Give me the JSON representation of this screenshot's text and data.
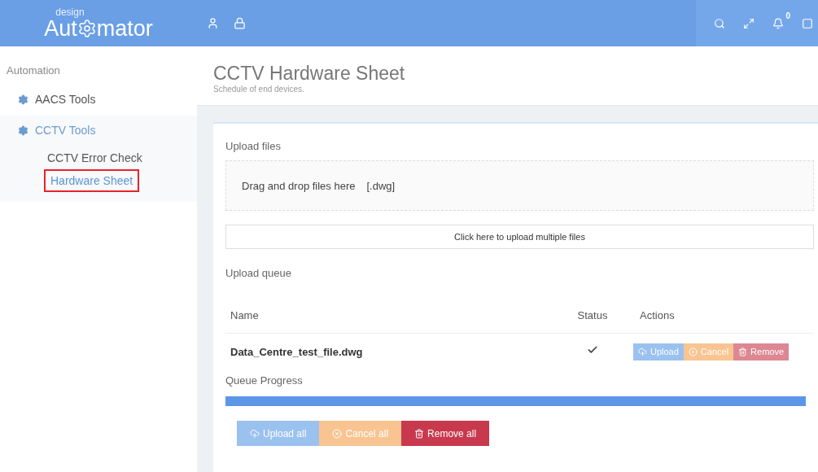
{
  "logo": {
    "small": "design",
    "left": "Aut",
    "right": "mator"
  },
  "header": {
    "notification_count": "0"
  },
  "sidebar": {
    "heading": "Automation",
    "items": [
      {
        "label": "AACS Tools",
        "expanded": false
      },
      {
        "label": "CCTV Tools",
        "expanded": true,
        "children": [
          {
            "label": "CCTV Error Check",
            "selected": false
          },
          {
            "label": "Hardware Sheet",
            "selected": true
          }
        ]
      }
    ]
  },
  "page": {
    "title": "CCTV Hardware Sheet",
    "subtitle": "Schedule of end devices."
  },
  "upload": {
    "heading": "Upload files",
    "drop_text": "Drag and drop files here",
    "drop_ext": "[.dwg]",
    "click_text": "Click here to upload multiple files"
  },
  "queue": {
    "heading": "Upload queue",
    "columns": [
      "Name",
      "Status",
      "Actions"
    ],
    "rows": [
      {
        "name": "Data_Centre_test_file.dwg",
        "done": true,
        "actions": [
          {
            "kind": "upload",
            "label": "Upload",
            "disabled": true
          },
          {
            "kind": "cancel",
            "label": "Cancel",
            "disabled": true
          },
          {
            "kind": "remove",
            "label": "Remove",
            "disabled": true
          }
        ]
      }
    ],
    "progress_label": "Queue Progress",
    "progress": {
      "level": 1
    },
    "buttons": [
      {
        "kind": "upload",
        "label": "Upload all",
        "disabled": true
      },
      {
        "kind": "cancel",
        "label": "Cancel all",
        "disabled": true
      },
      {
        "kind": "remove",
        "label": "Remove all",
        "disabled": false
      }
    ]
  }
}
